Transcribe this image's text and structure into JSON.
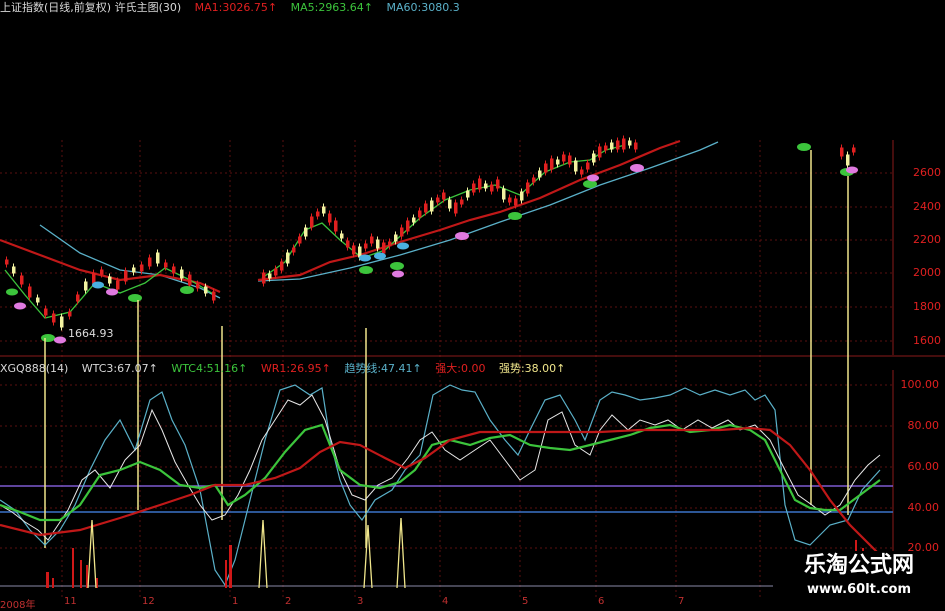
{
  "main_legend": {
    "title": "上证指数(日线,前复权) 许氏主图(30)",
    "ma1": "MA1:3026.75↑",
    "ma5": "MA5:2963.64↑",
    "ma60": "MA60:3080.3"
  },
  "indicator_legend": {
    "name": "XGQ888(14)",
    "wtc3": "WTC3:67.07↑",
    "wtc4": "WTC4:51.16↑",
    "wr1": "WR1:26.95↑",
    "trend": "趋势线:47.41↑",
    "strong_big": "强大:0.00",
    "strength": "强势:38.00↑"
  },
  "price_axis": [
    "2600",
    "2400",
    "2200",
    "2000",
    "1800",
    "1600"
  ],
  "indicator_axis": [
    "100.00",
    "80.00",
    "60.00",
    "40.00",
    "20.00"
  ],
  "low_label": "1664.93",
  "date_axis": [
    "2008年",
    "11",
    "12",
    "1",
    "2",
    "3",
    "4",
    "5",
    "6",
    "7"
  ],
  "watermark": {
    "name": "乐淘公式网",
    "url": "www.60lt.com"
  },
  "colors": {
    "up": "#e02020",
    "ma_red": "#c01818",
    "ma_cyan": "#5ab0c8",
    "ma_green": "#3cc43c",
    "vline": "#f0e68c",
    "grid": "#5a1010"
  }
}
